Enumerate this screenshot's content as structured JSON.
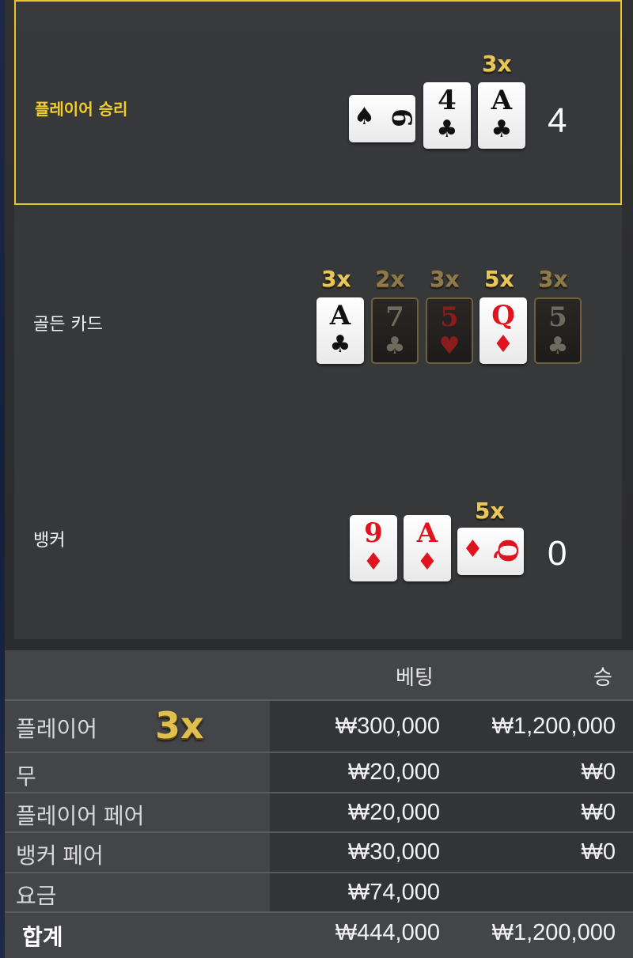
{
  "player": {
    "label": "플레이어 승리",
    "score": "4",
    "cards": [
      {
        "rank": "6",
        "suit": "♠",
        "color": "black",
        "orientation": "sideways"
      },
      {
        "rank": "4",
        "suit": "♣",
        "color": "black"
      },
      {
        "rank": "A",
        "suit": "♣",
        "color": "black",
        "multiplier": "3x"
      }
    ]
  },
  "golden": {
    "label": "골든 카드",
    "cards": [
      {
        "rank": "A",
        "suit": "♣",
        "color": "black",
        "multiplier": "3x",
        "active": true
      },
      {
        "rank": "7",
        "suit": "♣",
        "color": "black",
        "multiplier": "2x",
        "active": false
      },
      {
        "rank": "5",
        "suit": "♥",
        "color": "red",
        "multiplier": "3x",
        "active": false
      },
      {
        "rank": "Q",
        "suit": "♦",
        "color": "red",
        "multiplier": "5x",
        "active": true
      },
      {
        "rank": "5",
        "suit": "♣",
        "color": "black",
        "multiplier": "3x",
        "active": false
      }
    ]
  },
  "banker": {
    "label": "뱅커",
    "score": "0",
    "cards": [
      {
        "rank": "9",
        "suit": "♦",
        "color": "red"
      },
      {
        "rank": "A",
        "suit": "♦",
        "color": "red"
      },
      {
        "rank": "Q",
        "suit": "♦",
        "color": "red",
        "orientation": "sideways",
        "multiplier": "5x"
      }
    ]
  },
  "results": {
    "headers": {
      "bet": "베팅",
      "win": "승"
    },
    "highlight_multiplier": "3x",
    "rows": [
      {
        "label": "플레이어",
        "bet": "₩300,000",
        "win": "₩1,200,000"
      },
      {
        "label": "무",
        "bet": "₩20,000",
        "win": "₩0"
      },
      {
        "label": "플레이어 페어",
        "bet": "₩20,000",
        "win": "₩0"
      },
      {
        "label": "뱅커 페어",
        "bet": "₩30,000",
        "win": "₩0"
      },
      {
        "label": "요금",
        "bet": "₩74,000",
        "win": ""
      }
    ],
    "total": {
      "label": "합계",
      "bet": "₩444,000",
      "win": "₩1,200,000"
    }
  },
  "colors": {
    "highlight_border": "#e8c62a",
    "multiplier_gold": "#e7c75a",
    "red_suit": "#e0141e"
  }
}
